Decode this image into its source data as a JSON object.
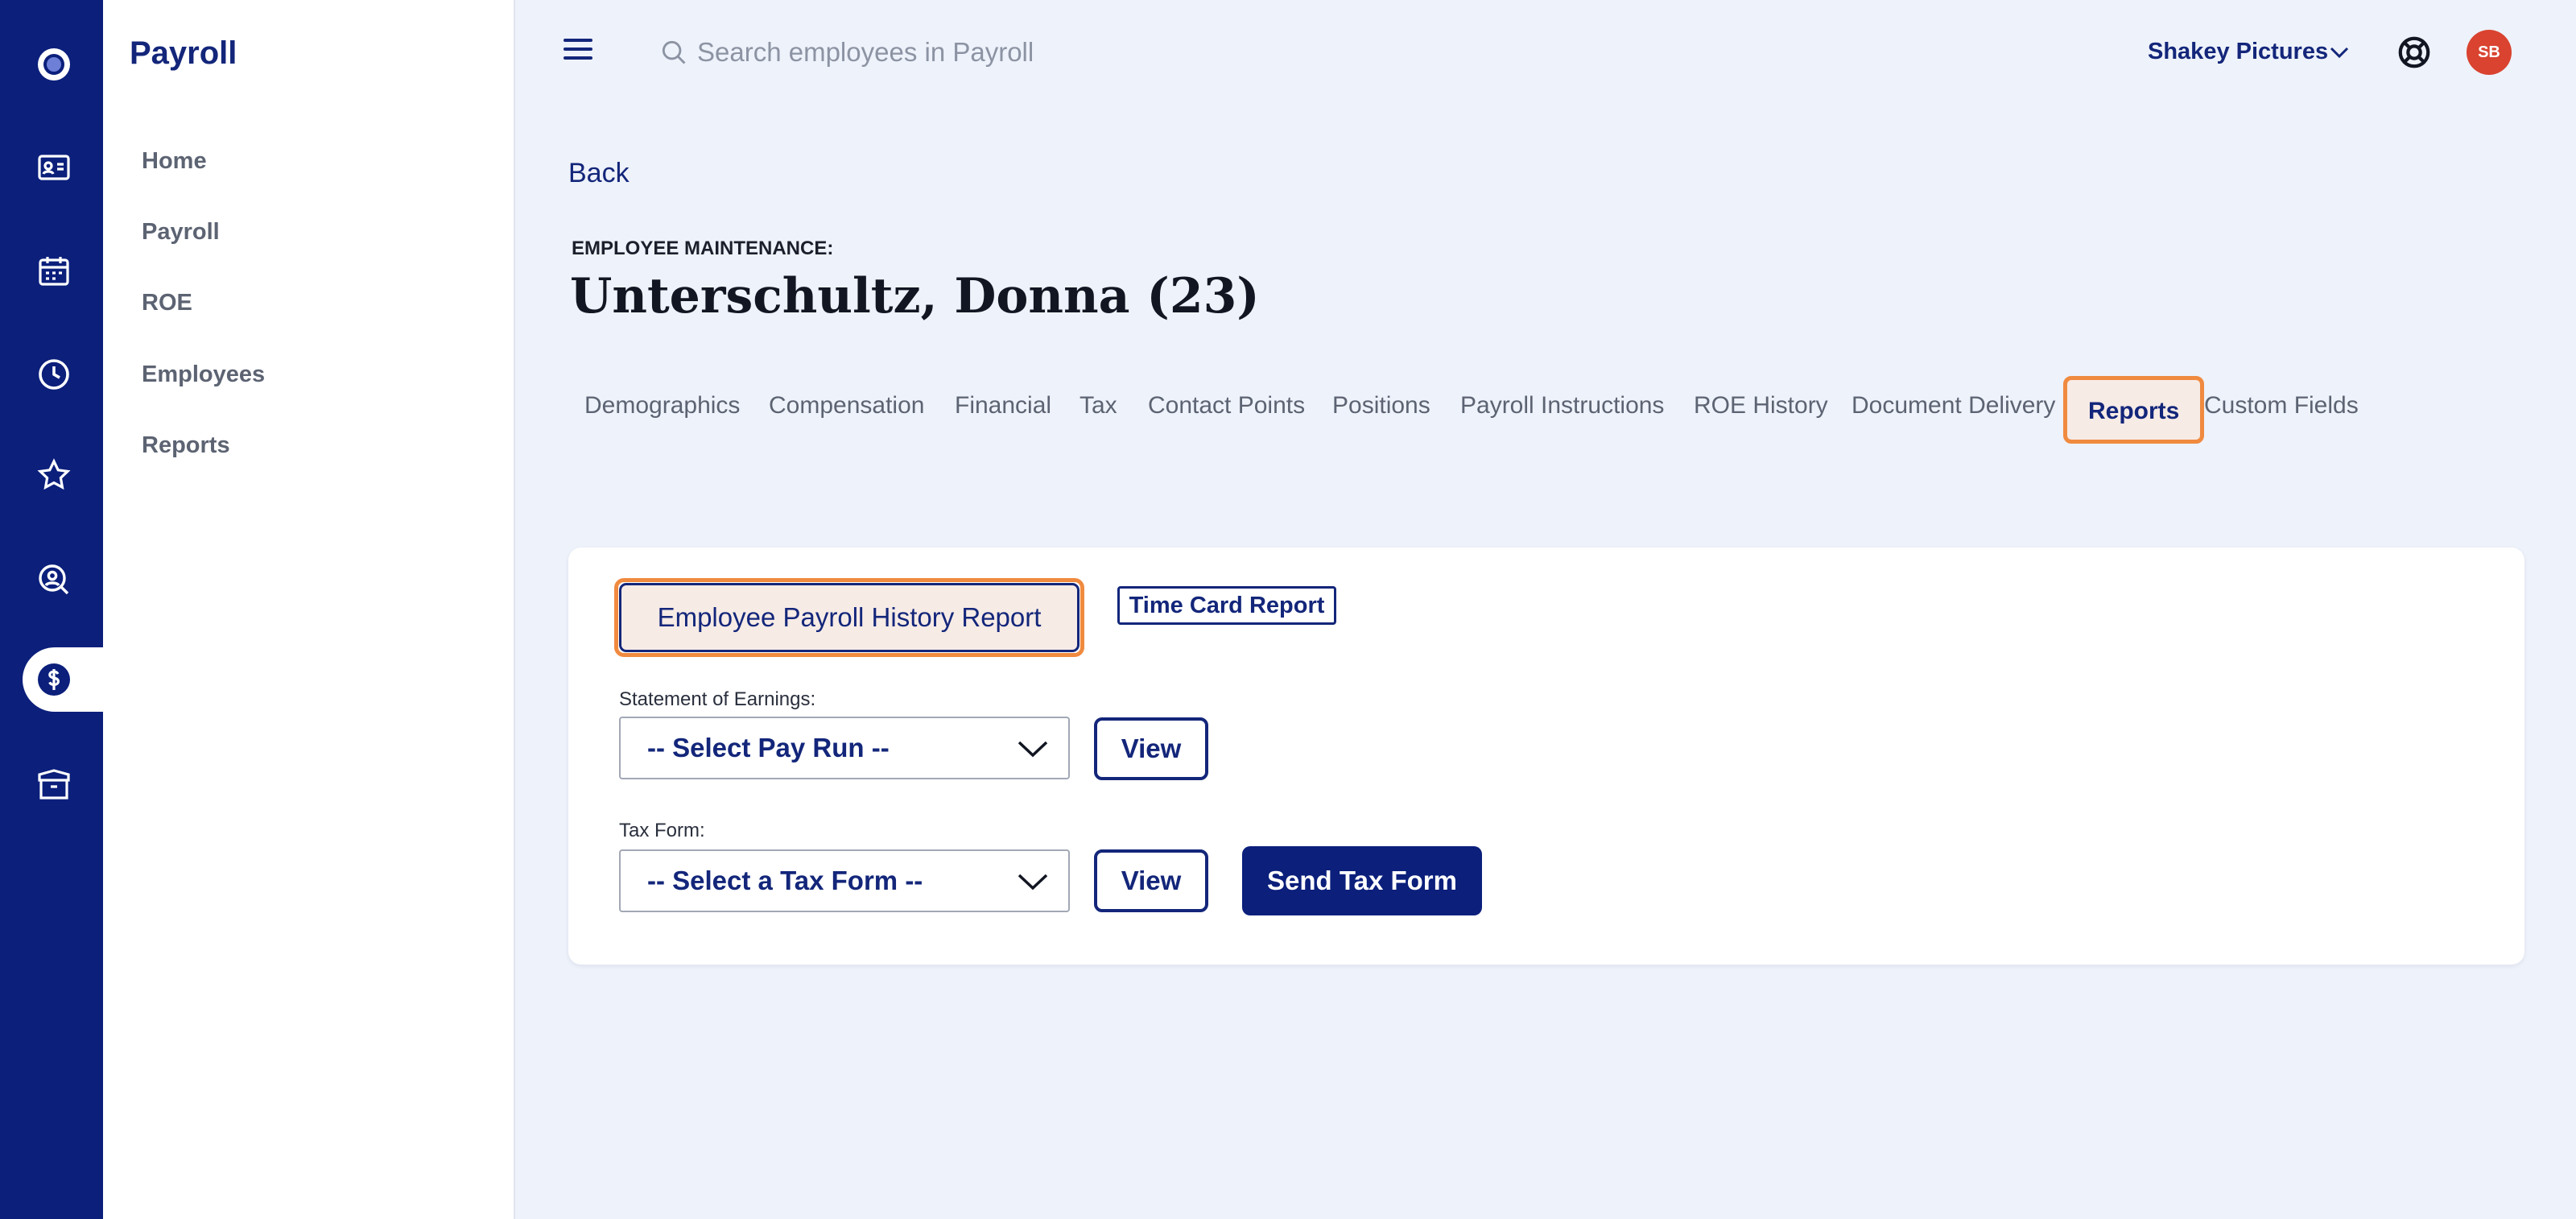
{
  "rail": {
    "icons": [
      "app-logo-icon",
      "id-card-icon",
      "calendar-icon",
      "clock-icon",
      "star-icon",
      "person-search-icon",
      "dollar-icon",
      "box-icon"
    ],
    "active": "dollar-icon"
  },
  "sidebar": {
    "title": "Payroll",
    "items": [
      {
        "label": "Home"
      },
      {
        "label": "Payroll"
      },
      {
        "label": "ROE"
      },
      {
        "label": "Employees"
      },
      {
        "label": "Reports"
      }
    ]
  },
  "topbar": {
    "search_placeholder": "Search employees in Payroll",
    "company": "Shakey Pictures",
    "avatar_initials": "SB"
  },
  "page": {
    "back": "Back",
    "eyebrow": "EMPLOYEE MAINTENANCE:",
    "title": "Unterschultz, Donna (23)"
  },
  "tabs": [
    "Demographics",
    "Compensation",
    "Financial",
    "Tax",
    "Contact Points",
    "Positions",
    "Payroll Instructions",
    "ROE History",
    "Document Delivery",
    "Reports",
    "Custom Fields"
  ],
  "active_tab": "Reports",
  "reports": {
    "payroll_history_button": "Employee Payroll History Report",
    "time_card_button": "Time Card Report",
    "soe_label": "Statement of Earnings:",
    "soe_select": "-- Select Pay Run --",
    "view": "View",
    "tax_label": "Tax Form:",
    "tax_select": "-- Select a Tax Form --",
    "send_tax": "Send Tax Form"
  },
  "colors": {
    "brand_navy": "#0b1f7b",
    "highlight_orange": "#f08a3f",
    "avatar_red": "#d9432f",
    "page_bg": "#eef2fa"
  }
}
